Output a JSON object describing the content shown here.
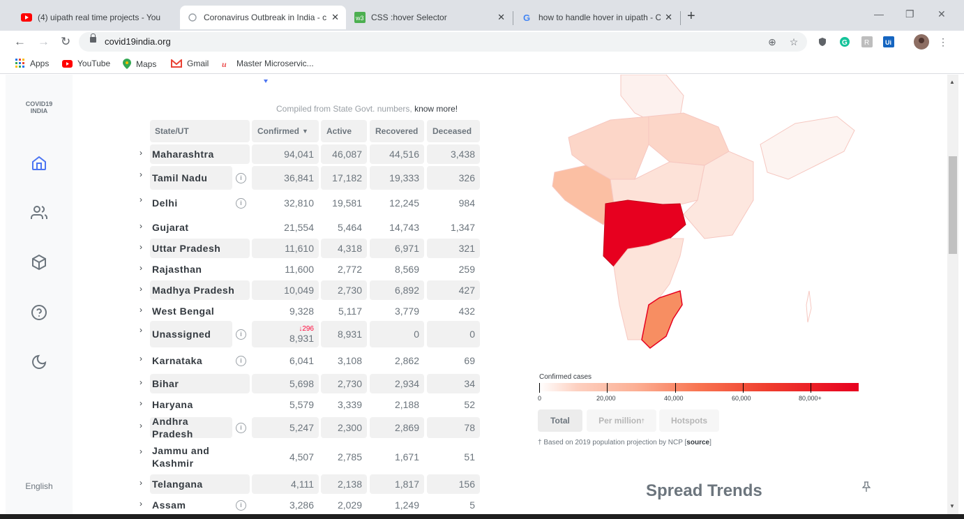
{
  "browser": {
    "tabs": [
      {
        "title": "(4) uipath real time projects - You"
      },
      {
        "title": "Coronavirus Outbreak in India - c"
      },
      {
        "title": "CSS :hover Selector"
      },
      {
        "title": "how to handle hover in uipath - C"
      }
    ],
    "url": "covid19india.org",
    "bookmarks": [
      "Apps",
      "YouTube",
      "Maps",
      "Gmail",
      "Master Microservic..."
    ]
  },
  "sidebar": {
    "logo_line1": "COVID19",
    "logo_line2": "INDIA",
    "language": "English"
  },
  "table": {
    "compiled_prefix": "Compiled from State Govt. numbers, ",
    "compiled_link": "know more!",
    "headers": {
      "state": "State/UT",
      "confirmed": "Confirmed",
      "active": "Active",
      "recovered": "Recovered",
      "deceased": "Deceased"
    },
    "rows": [
      {
        "state": "Maharashtra",
        "confirmed": "94,041",
        "active": "46,087",
        "recovered": "44,516",
        "deceased": "3,438",
        "info": false,
        "delta": ""
      },
      {
        "state": "Tamil Nadu",
        "confirmed": "36,841",
        "active": "17,182",
        "recovered": "19,333",
        "deceased": "326",
        "info": true,
        "delta": ""
      },
      {
        "state": "Delhi",
        "confirmed": "32,810",
        "active": "19,581",
        "recovered": "12,245",
        "deceased": "984",
        "info": true,
        "delta": ""
      },
      {
        "state": "Gujarat",
        "confirmed": "21,554",
        "active": "5,464",
        "recovered": "14,743",
        "deceased": "1,347",
        "info": false,
        "delta": ""
      },
      {
        "state": "Uttar Pradesh",
        "confirmed": "11,610",
        "active": "4,318",
        "recovered": "6,971",
        "deceased": "321",
        "info": false,
        "delta": ""
      },
      {
        "state": "Rajasthan",
        "confirmed": "11,600",
        "active": "2,772",
        "recovered": "8,569",
        "deceased": "259",
        "info": false,
        "delta": ""
      },
      {
        "state": "Madhya Pradesh",
        "confirmed": "10,049",
        "active": "2,730",
        "recovered": "6,892",
        "deceased": "427",
        "info": false,
        "delta": ""
      },
      {
        "state": "West Bengal",
        "confirmed": "9,328",
        "active": "5,117",
        "recovered": "3,779",
        "deceased": "432",
        "info": false,
        "delta": ""
      },
      {
        "state": "Unassigned",
        "confirmed": "8,931",
        "active": "8,931",
        "recovered": "0",
        "deceased": "0",
        "info": true,
        "delta": "↓296"
      },
      {
        "state": "Karnataka",
        "confirmed": "6,041",
        "active": "3,108",
        "recovered": "2,862",
        "deceased": "69",
        "info": true,
        "delta": ""
      },
      {
        "state": "Bihar",
        "confirmed": "5,698",
        "active": "2,730",
        "recovered": "2,934",
        "deceased": "34",
        "info": false,
        "delta": ""
      },
      {
        "state": "Haryana",
        "confirmed": "5,579",
        "active": "3,339",
        "recovered": "2,188",
        "deceased": "52",
        "info": false,
        "delta": ""
      },
      {
        "state": "Andhra Pradesh",
        "confirmed": "5,247",
        "active": "2,300",
        "recovered": "2,869",
        "deceased": "78",
        "info": true,
        "delta": ""
      },
      {
        "state": "Jammu and Kashmir",
        "confirmed": "4,507",
        "active": "2,785",
        "recovered": "1,671",
        "deceased": "51",
        "info": false,
        "delta": ""
      },
      {
        "state": "Telangana",
        "confirmed": "4,111",
        "active": "2,138",
        "recovered": "1,817",
        "deceased": "156",
        "info": false,
        "delta": ""
      },
      {
        "state": "Assam",
        "confirmed": "3,286",
        "active": "2,029",
        "recovered": "1,249",
        "deceased": "5",
        "info": true,
        "delta": ""
      }
    ]
  },
  "map": {
    "legend_title": "Confirmed cases",
    "legend_labels": [
      "0",
      "20,000",
      "40,000",
      "60,000",
      "80,000+"
    ],
    "buttons": [
      "Total",
      "Per million",
      "Hotspots"
    ],
    "per_million_sup": "†",
    "note_prefix": "† Based on 2019 population projection by NCP [",
    "note_link": "source",
    "note_suffix": "]"
  },
  "spread_title": "Spread Trends",
  "colors": {
    "confirmed_red": "#ff073a",
    "map_max": "#e7001f"
  }
}
